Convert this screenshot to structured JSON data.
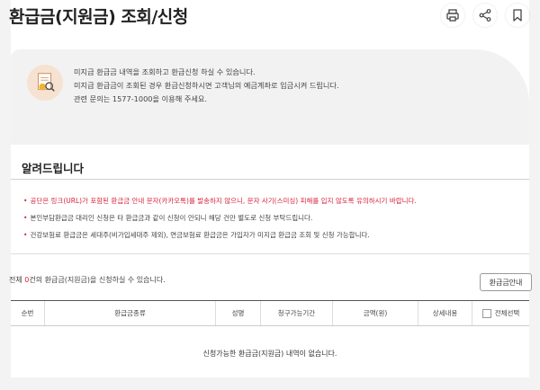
{
  "page": {
    "title": "환급금(지원금) 조회/신청"
  },
  "actions": {
    "print_icon": "printer-icon",
    "share_icon": "share-icon",
    "bookmark_icon": "bookmark-icon"
  },
  "info": {
    "icon": "document-search-icon",
    "lines": [
      "미지급 환급금 내역을 조회하고 환급신청 하실 수 있습니다.",
      "미지급 환급금이 조회된 경우 환급신청하시면 고객님의 예금계좌로 입금시켜 드립니다.",
      "관련 문의는 1577-1000을 이용해 주세요."
    ]
  },
  "notice": {
    "title": "알려드립니다",
    "items": [
      "공단은 링크(URL)가 포함된 환급금 안내 문자(카카오톡)를 발송하지 않으니, 문자 사기(스미싱) 피해를 입지 않도록 유의하시기 바랍니다.",
      "본인부담환급금 대리인 신청은 타 환급금과 같이 신청이 안되니 해당 건만 별도로 신청 부탁드립니다.",
      "건강보험료 환급금은 세대주(비가입세대주 제외), 연금보험료 환급금은 가입자가 미지급 환급금 조회 및 신청 가능합니다."
    ]
  },
  "summary": {
    "prefix": "전체 ",
    "count": "0",
    "suffix": "건의 환급금(지원금)을 신청하실 수 있습니다."
  },
  "guide_button": "환급금안내",
  "table": {
    "columns": [
      "순번",
      "환급금종류",
      "성명",
      "청구가능기간",
      "금액(원)",
      "상세내용",
      "전체선택"
    ],
    "empty_message": "신청가능한 환급금(지원금) 내역이 없습니다."
  },
  "colors": {
    "accent_red": "#d8233a",
    "info_bg": "#f2f2f2"
  }
}
